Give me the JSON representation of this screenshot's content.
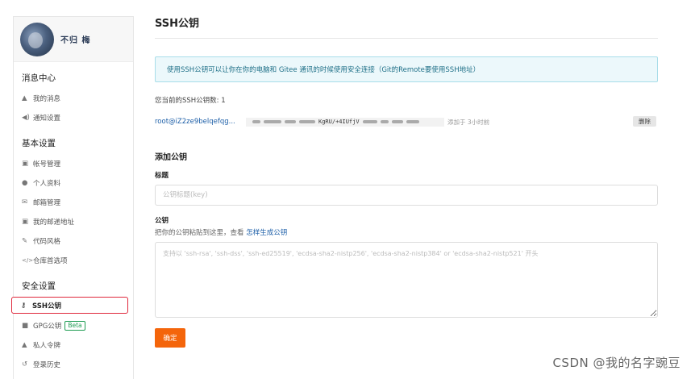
{
  "profile": {
    "username": "不归 梅"
  },
  "sidebar": {
    "groups": [
      {
        "title": "消息中心",
        "items": [
          {
            "icon": "bell-icon",
            "glyph": "🔔",
            "label": "我的消息"
          },
          {
            "icon": "speaker-icon",
            "glyph": "◀)",
            "label": "通知设置"
          }
        ]
      },
      {
        "title": "基本设置",
        "items": [
          {
            "icon": "id-card-icon",
            "glyph": "▣",
            "label": "帐号管理"
          },
          {
            "icon": "user-icon",
            "glyph": "👤",
            "label": "个人资料"
          },
          {
            "icon": "mail-icon",
            "glyph": "✉",
            "label": "邮箱管理"
          },
          {
            "icon": "address-card-icon",
            "glyph": "▣",
            "label": "我的邮递地址"
          },
          {
            "icon": "brush-icon",
            "glyph": "✎",
            "label": "代码风格"
          },
          {
            "icon": "code-icon",
            "glyph": "</>",
            "label": "仓库首选项"
          }
        ]
      },
      {
        "title": "安全设置",
        "items": [
          {
            "icon": "key-icon",
            "glyph": "🔑",
            "label": "SSH公钥"
          },
          {
            "icon": "lock-icon",
            "glyph": "🔒",
            "label": "GPG公钥",
            "badge": "Beta"
          },
          {
            "icon": "person-lock-icon",
            "glyph": "👤",
            "label": "私人令牌"
          },
          {
            "icon": "history-icon",
            "glyph": "↺",
            "label": "登录历史"
          }
        ]
      }
    ]
  },
  "main": {
    "title": "SSH公钥",
    "notice": "使用SSH公钥可以让你在你的电脑和 Gitee 通讯的时候使用安全连接（Git的Remote要使用SSH地址）",
    "count_text": "您当前的SSH公钥数: 1",
    "key": {
      "title": "root@iZ2ze9belqefqg...",
      "fingerprint_visible": "KgRU/+4IUfjV",
      "added": "添加于 3小时前",
      "delete_label": "删除"
    },
    "add_section_title": "添加公钥",
    "title_label": "标题",
    "title_placeholder": "公钥标题(key)",
    "key_label": "公钥",
    "key_hint_prefix": "把你的公钥粘贴到这里，查看 ",
    "key_hint_link": "怎样生成公钥",
    "key_placeholder": "支持以 'ssh-rsa', 'ssh-dss', 'ssh-ed25519', 'ecdsa-sha2-nistp256', 'ecdsa-sha2-nistp384' or 'ecdsa-sha2-nistp521' 开头",
    "confirm_label": "确定"
  },
  "watermark": "CSDN @我的名字豌豆",
  "colors": {
    "accent": "#f4650b",
    "link": "#1d5fa8",
    "notice_bg": "#ecf8fb",
    "highlight_border": "#e0283c",
    "beta": "#1f9c52"
  }
}
